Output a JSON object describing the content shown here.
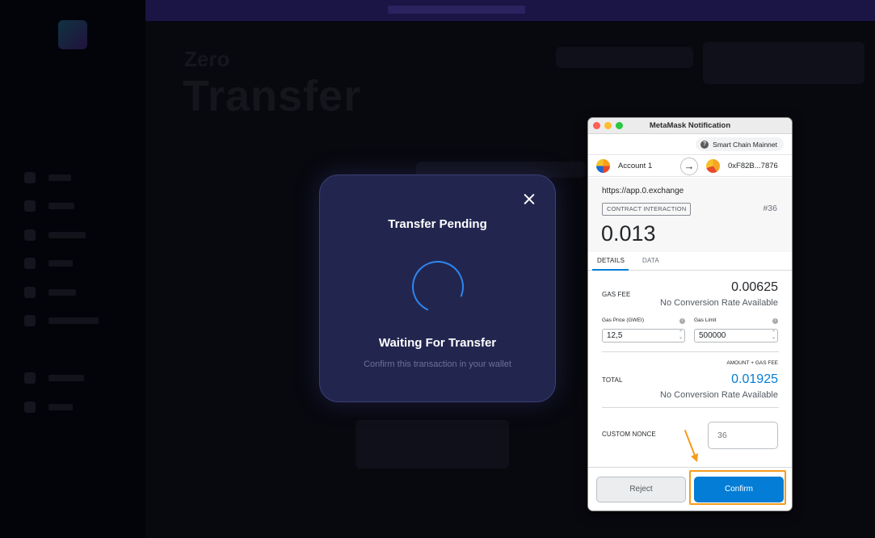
{
  "background_app": {
    "page_kicker": "Zero",
    "page_title": "Transfer"
  },
  "transfer_modal": {
    "title": "Transfer Pending",
    "status": "Waiting For Transfer",
    "hint": "Confirm this transaction in your wallet",
    "close_icon": "close-icon",
    "spinner_color": "#2f86f0"
  },
  "metamask": {
    "window_title": "MetaMask Notification",
    "network": "Smart Chain Mainnet",
    "from_account": "Account 1",
    "to_address": "0xF82B...7876",
    "origin": "https://app.0.exchange",
    "badge": "CONTRACT INTERACTION",
    "tx_number": "#36",
    "amount": "0.013",
    "tabs": [
      "DETAILS",
      "DATA"
    ],
    "gas_fee_label": "GAS FEE",
    "gas_fee_value": "0.00625",
    "no_conversion": "No Conversion Rate Available",
    "gas_price_label": "Gas Price (GWEI)",
    "gas_price_value": "12,5",
    "gas_limit_label": "Gas Limit",
    "gas_limit_value": "500000",
    "amount_gas_label": "AMOUNT + GAS FEE",
    "total_label": "TOTAL",
    "total_value": "0.01925",
    "custom_nonce_label": "CUSTOM NONCE",
    "custom_nonce_placeholder": "36",
    "reject_label": "Reject",
    "confirm_label": "Confirm",
    "accent_color": "#037dd6"
  },
  "annotation": {
    "color": "#f59c1c"
  }
}
